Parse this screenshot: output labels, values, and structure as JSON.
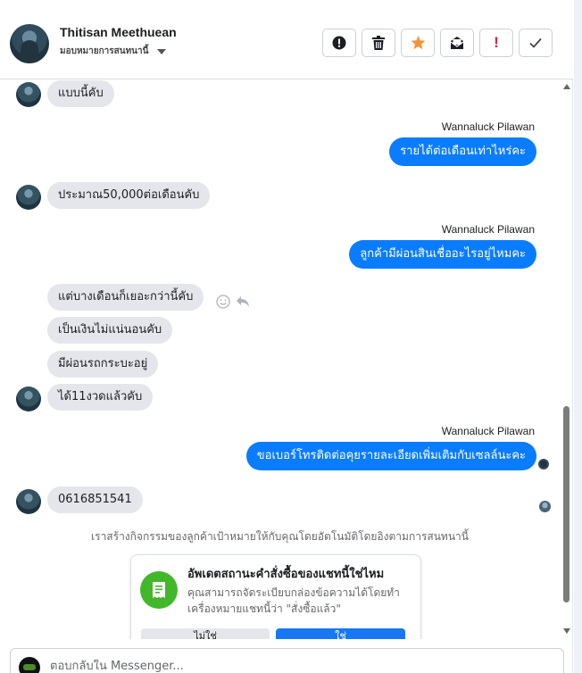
{
  "header": {
    "contact_name": "Thitisan Meethuean",
    "assign_label": "มอบหมายการสนทนานี้",
    "actions": [
      {
        "name": "report-spam-button",
        "icon": "alert-circle-icon"
      },
      {
        "name": "delete-button",
        "icon": "trash-icon"
      },
      {
        "name": "star-button",
        "icon": "star-icon",
        "color": "#f7923b"
      },
      {
        "name": "mark-unread-button",
        "icon": "envelope-icon"
      },
      {
        "name": "follow-up-button",
        "icon": "exclamation-icon",
        "label": "!",
        "color": "#e41e3f"
      },
      {
        "name": "mark-done-button",
        "icon": "check-icon"
      }
    ]
  },
  "messages": [
    {
      "side": "in",
      "text": "แบบนี้คับ",
      "avatar": true
    },
    {
      "side": "out",
      "sender": "Wannaluck Pilawan",
      "text": "รายได้ต่อเดือนเท่าไหร่คะ"
    },
    {
      "side": "in",
      "text": "ประมาณ50,000ต่อเดือนคับ",
      "avatar": true
    },
    {
      "side": "out",
      "sender": "Wannaluck Pilawan",
      "text": "ลูกค้ามีผ่อนสินเชื่ออะไรอยู่ไหมคะ"
    },
    {
      "side": "in",
      "text": "แต่บางเดือนก็เยอะกว่านี้คับ",
      "avatar": false
    },
    {
      "side": "in",
      "text": "เป็นเงินไม่แน่นอนคับ",
      "avatar": false
    },
    {
      "side": "in",
      "text": "มีผ่อนรถกระบะอยู่",
      "avatar": false
    },
    {
      "side": "in",
      "text": "ได้11งวดแล้วคับ",
      "avatar": true
    },
    {
      "side": "out",
      "sender": "Wannaluck Pilawan",
      "text": "ขอเบอร์โทรติดต่อคุยรายละเอียดเพิ่มเติมกับเซลล์นะคะ"
    },
    {
      "side": "in",
      "text": "0616851541",
      "avatar": true
    }
  ],
  "system_note": "เราสร้างกิจกรรมของลูกค้าเป้าหมายให้กับคุณโดยอัตโนมัติโดยอิงตามการสนทนานี้",
  "order_card": {
    "title": "อัพเดตสถานะคำสั่งซื้อของแชทนี้ใช่ไหม",
    "description": "คุณสามารถจัดระเบียบกล่องข้อความได้โดยทำเครื่องหมายแชทนี้ว่า \"สั่งซื้อแล้ว\"",
    "no_label": "ไม่ใช่",
    "yes_label": "ใช่"
  },
  "composer": {
    "placeholder": "ตอบกลับใน Messenger..."
  },
  "colors": {
    "outgoing_bubble": "#0a7cff",
    "incoming_bubble": "#e4e6eb",
    "accept_button": "#1877f2",
    "order_icon_bg": "#42b72a"
  }
}
